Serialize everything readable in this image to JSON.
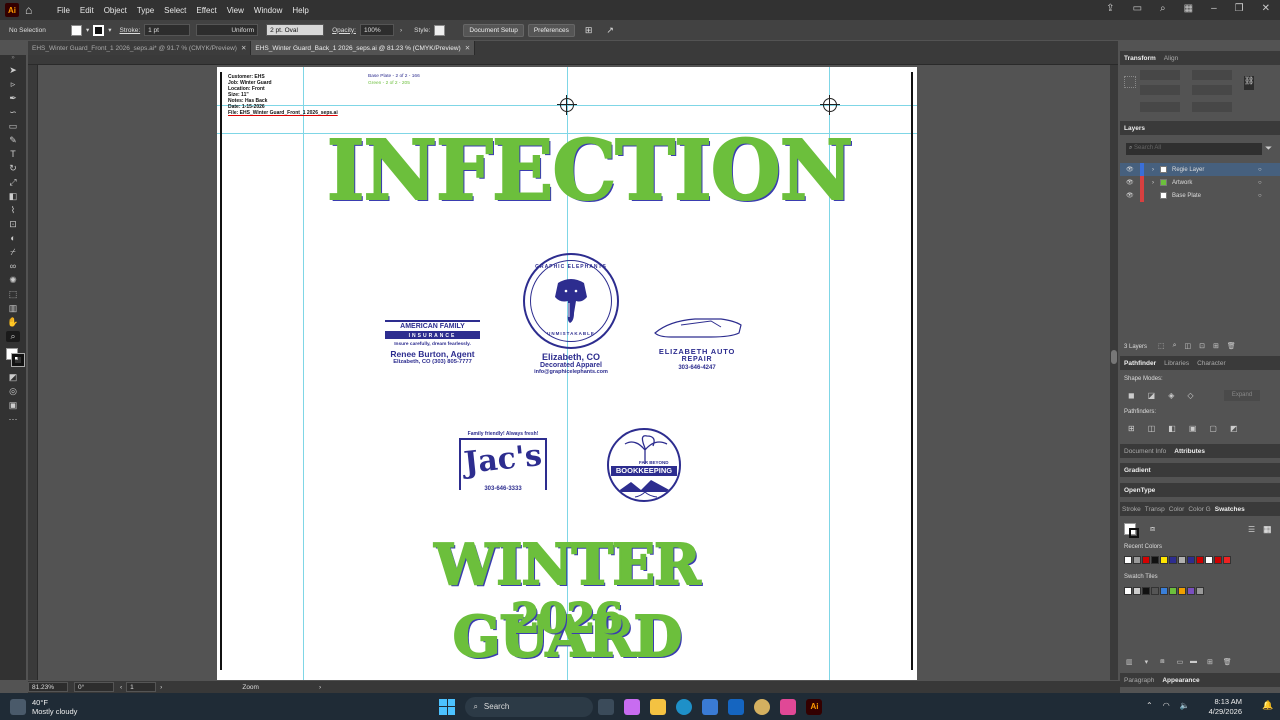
{
  "app": {
    "logo": "Ai"
  },
  "menu": [
    "File",
    "Edit",
    "Object",
    "Type",
    "Select",
    "Effect",
    "View",
    "Window",
    "Help"
  ],
  "control_bar": {
    "selection": "No Selection",
    "stroke_label": "Stroke:",
    "stroke_value": "1 pt",
    "profile": "Uniform",
    "brush": "2 pt. Oval",
    "opacity_label": "Opacity:",
    "opacity_value": "100%",
    "style_label": "Style:",
    "document_setup": "Document Setup",
    "preferences": "Preferences"
  },
  "tabs": [
    {
      "label": "EHS_Winter Guard_Front_1 2026_seps.ai* @ 91.7 % (CMYK/Preview)",
      "active": false
    },
    {
      "label": "EHS_Winter Guard_Back_1 2026_seps.ai @ 81.23 % (CMYK/Preview)",
      "active": true
    }
  ],
  "artboard": {
    "job_info": [
      "Customer: EHS",
      "Job: Winter Guard",
      "Location: Front",
      "Size: 11\"",
      "Notes: Has Back",
      "Date: 1-15-2026",
      "File: EHS_Winter Guard_Front_1 2026_seps.ai"
    ],
    "plate_base": "Base Plate - 2 of 2 - 166",
    "plate_green": "Green - 2 of 2 - 205",
    "headline": "INFECTION",
    "footer_title": "WINTER GUARD",
    "footer_year": "2026",
    "afi": {
      "line1": "AMERICAN FAMILY",
      "line2": "INSURANCE",
      "tagline": "Insure carefully, dream fearlessly.",
      "agent": "Renee Burton, Agent",
      "contact": "Elizabeth, CO (303) 805-7777"
    },
    "ge": {
      "ring_top": "GRAPHIC ELEPHANTS",
      "ring_bottom": "UNMISTAKABLE",
      "line1": "Elizabeth, CO",
      "line2": "Decorated Apparel",
      "email": "info@graphicelephants.com"
    },
    "auto": {
      "line1": "ELIZABETH AUTO",
      "line2": "REPAIR",
      "phone": "303-646-4247"
    },
    "jacs": {
      "tagline": "Family friendly! Always fresh!",
      "name": "Jac's",
      "phone": "303-646-3333"
    },
    "fbb": {
      "line1": "FAR BEYOND",
      "line2": "BOOKKEEPING"
    }
  },
  "panels": {
    "transform_tabs": [
      "Transform",
      "Align"
    ],
    "layers_title": "Layers",
    "search_placeholder": "Search All",
    "layers": [
      {
        "name": "Regie Layer",
        "selected": true
      },
      {
        "name": "Artwork",
        "selected": false
      },
      {
        "name": "Base Plate",
        "selected": false
      }
    ],
    "layers_count": "3 Layers",
    "pathfinder_tabs": [
      "Pathfinder",
      "Libraries",
      "Character"
    ],
    "shape_modes": "Shape Modes:",
    "expand": "Expand",
    "pathfinders": "Pathfinders:",
    "docinfo_tabs": [
      "Document Info",
      "Attributes"
    ],
    "gradient": "Gradient",
    "opentype": "OpenType",
    "swatch_tabs": [
      "Stroke",
      "Transp",
      "Color",
      "Color G",
      "Swatches"
    ],
    "recent_colors": "Recent Colors",
    "swatch_tiles": "Swatch Tiles",
    "bottom_tabs": [
      "Paragraph",
      "Appearance"
    ],
    "recent_swatches": [
      "#ffffff",
      "#999999",
      "#d40000",
      "#111111",
      "#ffe600",
      "#2d2d8f",
      "#b0b0b0",
      "#2d2d8f",
      "#cc0000",
      "#ffffff",
      "#cc0000",
      "#ee2222"
    ],
    "tile_swatches": [
      "#ffffff",
      "#cccccc",
      "#111111",
      "#555555",
      "#3a7fd9",
      "#6cbf3c",
      "#f0a000",
      "#7a4fbf",
      "#999999"
    ]
  },
  "status": {
    "zoom": "81.23%",
    "rotate": "0°",
    "artboard": "1",
    "tool": "Zoom"
  },
  "taskbar": {
    "temp": "40°F",
    "weather": "Mostly cloudy",
    "search": "Search",
    "time": "8:13 AM",
    "date": "4/29/2026"
  },
  "colors": {
    "green": "#6cbf3c",
    "navy": "#2d2d8f",
    "guide": "#7fd6e6"
  }
}
